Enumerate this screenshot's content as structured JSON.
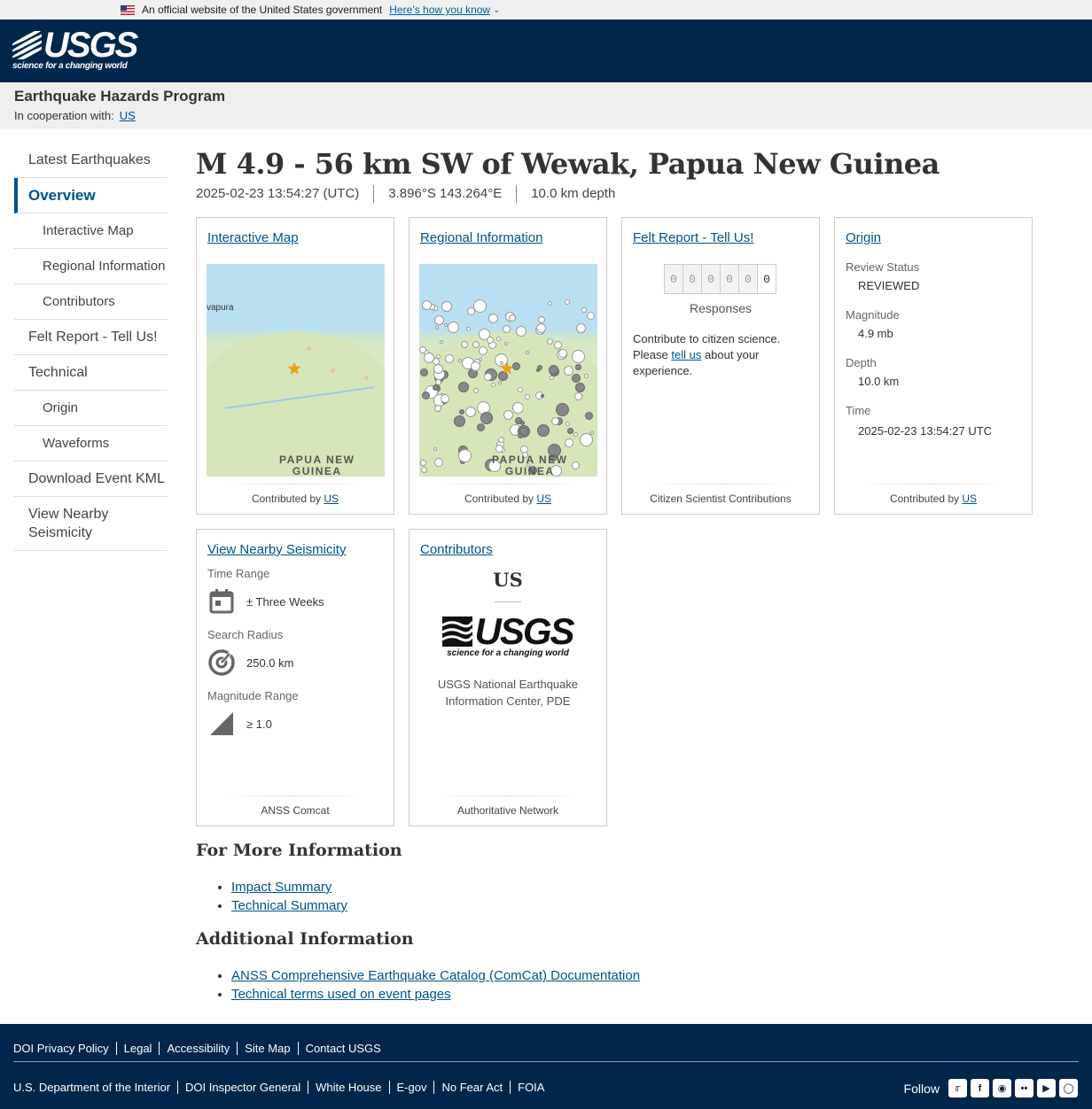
{
  "gov_banner": {
    "text": "An official website of the United States government",
    "how_link": "Here’s how you know"
  },
  "header": {
    "logo_text": "USGS",
    "logo_tagline": "science for a changing world"
  },
  "program": {
    "title": "Earthquake Hazards Program",
    "coop_label": "In cooperation with:",
    "coop_link": "US"
  },
  "sidebar": {
    "items": [
      {
        "label": "Latest Earthquakes"
      },
      {
        "label": "Overview"
      },
      {
        "label": "Interactive Map"
      },
      {
        "label": "Regional Information"
      },
      {
        "label": "Contributors"
      },
      {
        "label": "Felt Report - Tell Us!"
      },
      {
        "label": "Technical"
      },
      {
        "label": "Origin"
      },
      {
        "label": "Waveforms"
      },
      {
        "label": "Download Event KML"
      },
      {
        "label": "View Nearby Seismicity"
      }
    ]
  },
  "event": {
    "title": "M 4.9 - 56 km SW of Wewak, Papua New Guinea",
    "time": "2025-02-23 13:54:27 (UTC)",
    "location": "3.896°S 143.264°E",
    "depth": "10.0 km depth"
  },
  "cards": {
    "interactive_map": {
      "title": "Interactive Map",
      "map_label_1": "PAPUA NEW",
      "map_label_2": "GUINEA",
      "place": "vapura",
      "foot_prefix": "Contributed by ",
      "foot_link": "US"
    },
    "regional": {
      "title": "Regional Information",
      "map_label_1": "PAPUA NEW",
      "map_label_2": "GUINEA",
      "foot_prefix": "Contributed by ",
      "foot_link": "US"
    },
    "felt": {
      "title": "Felt Report - Tell Us!",
      "digits": [
        "0",
        "0",
        "0",
        "0",
        "0",
        "0"
      ],
      "responses": "Responses",
      "text_before": "Contribute to citizen science. Please ",
      "text_link": "tell us",
      "text_after": " about your experience.",
      "foot": "Citizen Scientist Contributions"
    },
    "origin": {
      "title": "Origin",
      "review_status_label": "Review Status",
      "review_status": "REVIEWED",
      "magnitude_label": "Magnitude",
      "magnitude": "4.9 mb",
      "depth_label": "Depth",
      "depth": "10.0 km",
      "time_label": "Time",
      "time": "2025-02-23 13:54:27 UTC",
      "foot_prefix": "Contributed by ",
      "foot_link": "US"
    },
    "nearby": {
      "title": "View Nearby Seismicity",
      "time_range_label": "Time Range",
      "time_range": "± Three Weeks",
      "radius_label": "Search Radius",
      "radius": "250.0 km",
      "mag_label": "Magnitude Range",
      "mag": "≥ 1.0",
      "foot": "ANSS Comcat"
    },
    "contributors": {
      "title": "Contributors",
      "code": "US",
      "logo_text": "USGS",
      "logo_tagline": "science for a changing world",
      "name": "USGS National Earthquake Information Center, PDE",
      "foot": "Authoritative Network"
    }
  },
  "more_info": {
    "heading": "For More Information",
    "links": [
      "Impact Summary",
      "Technical Summary"
    ]
  },
  "additional": {
    "heading": "Additional Information",
    "links": [
      "ANSS Comprehensive Earthquake Catalog (ComCat) Documentation",
      "Technical terms used on event pages"
    ]
  },
  "footer": {
    "row1": [
      "DOI Privacy Policy",
      "Legal",
      "Accessibility",
      "Site Map",
      "Contact USGS"
    ],
    "row2": [
      "U.S. Department of the Interior",
      "DOI Inspector General",
      "White House",
      "E-gov",
      "No Fear Act",
      "FOIA"
    ],
    "follow": "Follow",
    "social_icons": [
      "twitter-icon",
      "facebook-icon",
      "github-icon",
      "flickr-icon",
      "youtube-icon",
      "instagram-icon"
    ]
  },
  "colors": {
    "header_bg": "#00264c",
    "link": "#00528c",
    "star": "#f5a000"
  }
}
